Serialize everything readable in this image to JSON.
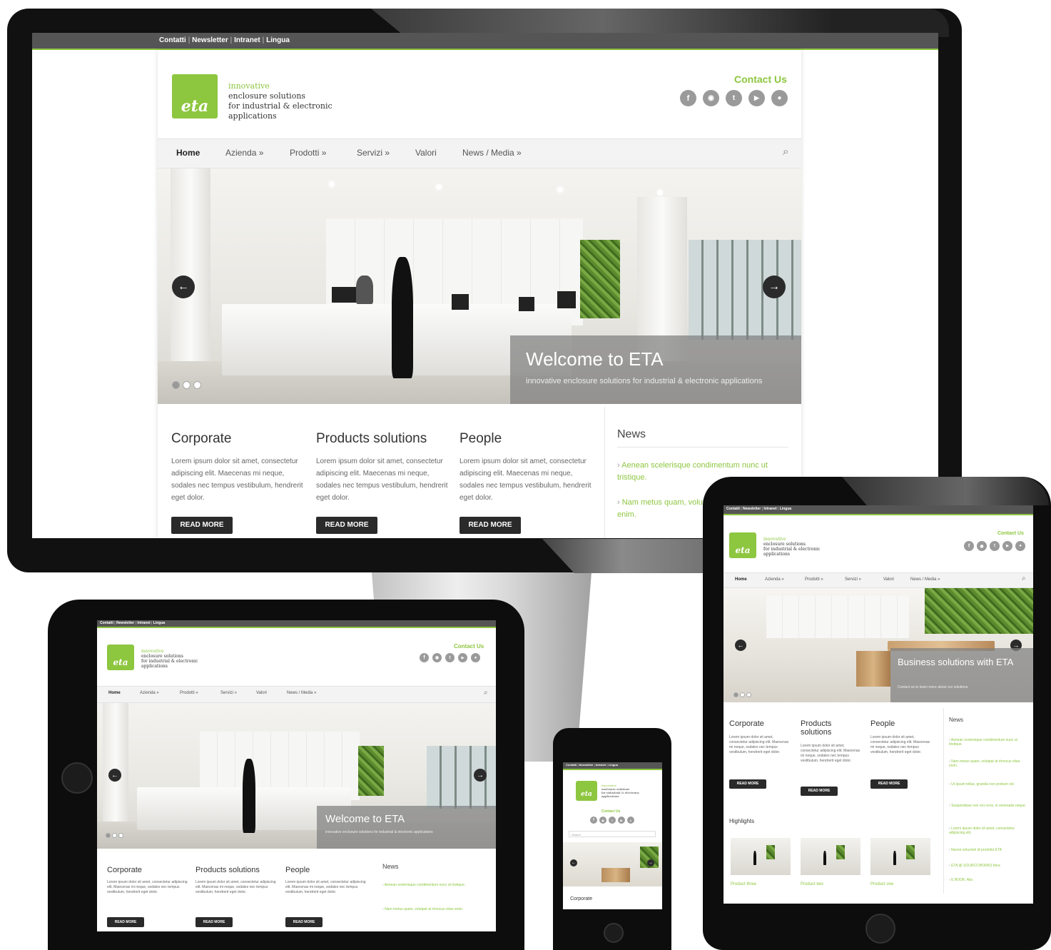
{
  "site": {
    "topbar_links": [
      "Contatti",
      "Newsletter",
      "Intranet",
      "Lingua"
    ],
    "logo_text": "eta",
    "tagline_accent": "innovative",
    "tagline_lines": [
      "enclosure solutions",
      "for industrial & electronic",
      "applications"
    ],
    "contact_label": "Contact Us",
    "social_icons": [
      "facebook-icon",
      "rss-icon",
      "twitter-icon",
      "youtube-icon",
      "flickr-icon"
    ],
    "nav_items": [
      "Home",
      "Azienda »",
      "Prodotti »",
      "Servizi »",
      "Valori",
      "News / Media »"
    ],
    "search_placeholder": "Search"
  },
  "desktop": {
    "hero_title": "Welcome to ETA",
    "hero_subtitle": "innovative enclosure solutions for industrial & electronic applications",
    "columns": [
      {
        "title": "Corporate",
        "text": "Lorem ipsum dolor sit amet, consectetur adipiscing elit. Maecenas mi neque, sodales nec tempus vestibulum, hendrerit eget dolor.",
        "button": "READ MORE"
      },
      {
        "title": "Products solutions",
        "text": "Lorem ipsum dolor sit amet, consectetur adipiscing elit. Maecenas mi neque, sodales nec tempus vestibulum, hendrerit eget dolor.",
        "button": "READ MORE"
      },
      {
        "title": "People",
        "text": "Lorem ipsum dolor sit amet, consectetur adipiscing elit. Maecenas mi neque, sodales nec tempus vestibulum, hendrerit eget dolor.",
        "button": "READ MORE"
      }
    ],
    "news_title": "News",
    "news_items": [
      "Aenean scelerisque condimentum nunc ut tristique.",
      "Nam metus quam, volutpat at rhoncus vitae enim."
    ]
  },
  "tablet_landscape": {
    "hero_title": "Welcome to ETA",
    "hero_subtitle": "innovative enclosure solutions for industrial & electronic applications",
    "columns": [
      "Corporate",
      "Products solutions",
      "People"
    ],
    "column_text": "Lorem ipsum dolor sit amet, consectetur adipiscing elit. Maecenas mi neque, sodales nec tempus vestibulum, hendrerit eget dolor.",
    "button": "READ MORE",
    "news_title": "News",
    "news_items": [
      "Aenean scelerisque condimentum nunc ut tristique.",
      "Nam metus quam, volutpat at rhoncus vitae enim."
    ]
  },
  "tablet_portrait": {
    "hero_title": "Business solutions with ETA",
    "hero_subtitle": "Contact us to learn more about our solutions",
    "columns": [
      "Corporate",
      "Products solutions",
      "People"
    ],
    "column_text": "Lorem ipsum dolor sit amet, consectetur adipiscing elit. Maecenas mi neque, sodales nec tempus vestibulum, hendrerit eget dolor.",
    "button": "READ MORE",
    "news_title": "News",
    "news_items": [
      "Aenean scelerisque condimentum nunc ut tristique.",
      "Nam metus quam, volutpat at rhoncus vitae enim.",
      "Ut ipsum tellus, gravida non pretium vel.",
      "Suspendisse non orci eros, in venenatis neque.",
      "Lorem ipsum dolor sit amet, consectetur adipiscing elit.",
      "Nuove soluzioni di prodotto ETA",
      "ETA @ SOURCCWORKS fiera",
      "E BOOK: Alia"
    ],
    "highlights_title": "Highlights",
    "highlights": [
      "Product three",
      "Product two",
      "Product one"
    ]
  },
  "phone": {
    "column_title": "Corporate"
  },
  "colors": {
    "accent": "#8dc63f",
    "topbar": "#555555",
    "bezel": "#111111",
    "button": "#2a2a2a"
  }
}
